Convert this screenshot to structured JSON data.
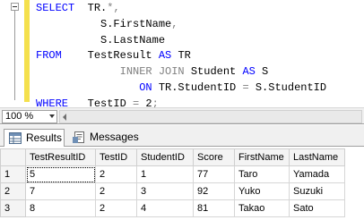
{
  "editor": {
    "lines": [
      [
        "SELECT",
        "  TR.",
        "*",
        ","
      ],
      [
        "S.FirstName",
        ","
      ],
      [
        "S.LastName"
      ],
      [
        "FROM",
        "    TestResult ",
        "AS",
        " TR"
      ],
      [
        "INNER JOIN",
        " Student ",
        "AS",
        " S"
      ],
      [
        "ON",
        " TR.StudentID ",
        "=",
        " S.StudentID"
      ],
      [
        "WHERE",
        "   TestID ",
        "=",
        " 2",
        ";"
      ]
    ]
  },
  "status": {
    "zoom": "100 %"
  },
  "tabs": {
    "results": "Results",
    "messages": "Messages"
  },
  "grid": {
    "columns": [
      "TestResultID",
      "TestID",
      "StudentID",
      "Score",
      "FirstName",
      "LastName"
    ],
    "rows": [
      {
        "num": "1",
        "cells": [
          "5",
          "2",
          "1",
          "77",
          "Taro",
          "Yamada"
        ]
      },
      {
        "num": "2",
        "cells": [
          "7",
          "2",
          "3",
          "92",
          "Yuko",
          "Suzuki"
        ]
      },
      {
        "num": "3",
        "cells": [
          "8",
          "2",
          "4",
          "81",
          "Takao",
          "Sato"
        ]
      }
    ]
  }
}
